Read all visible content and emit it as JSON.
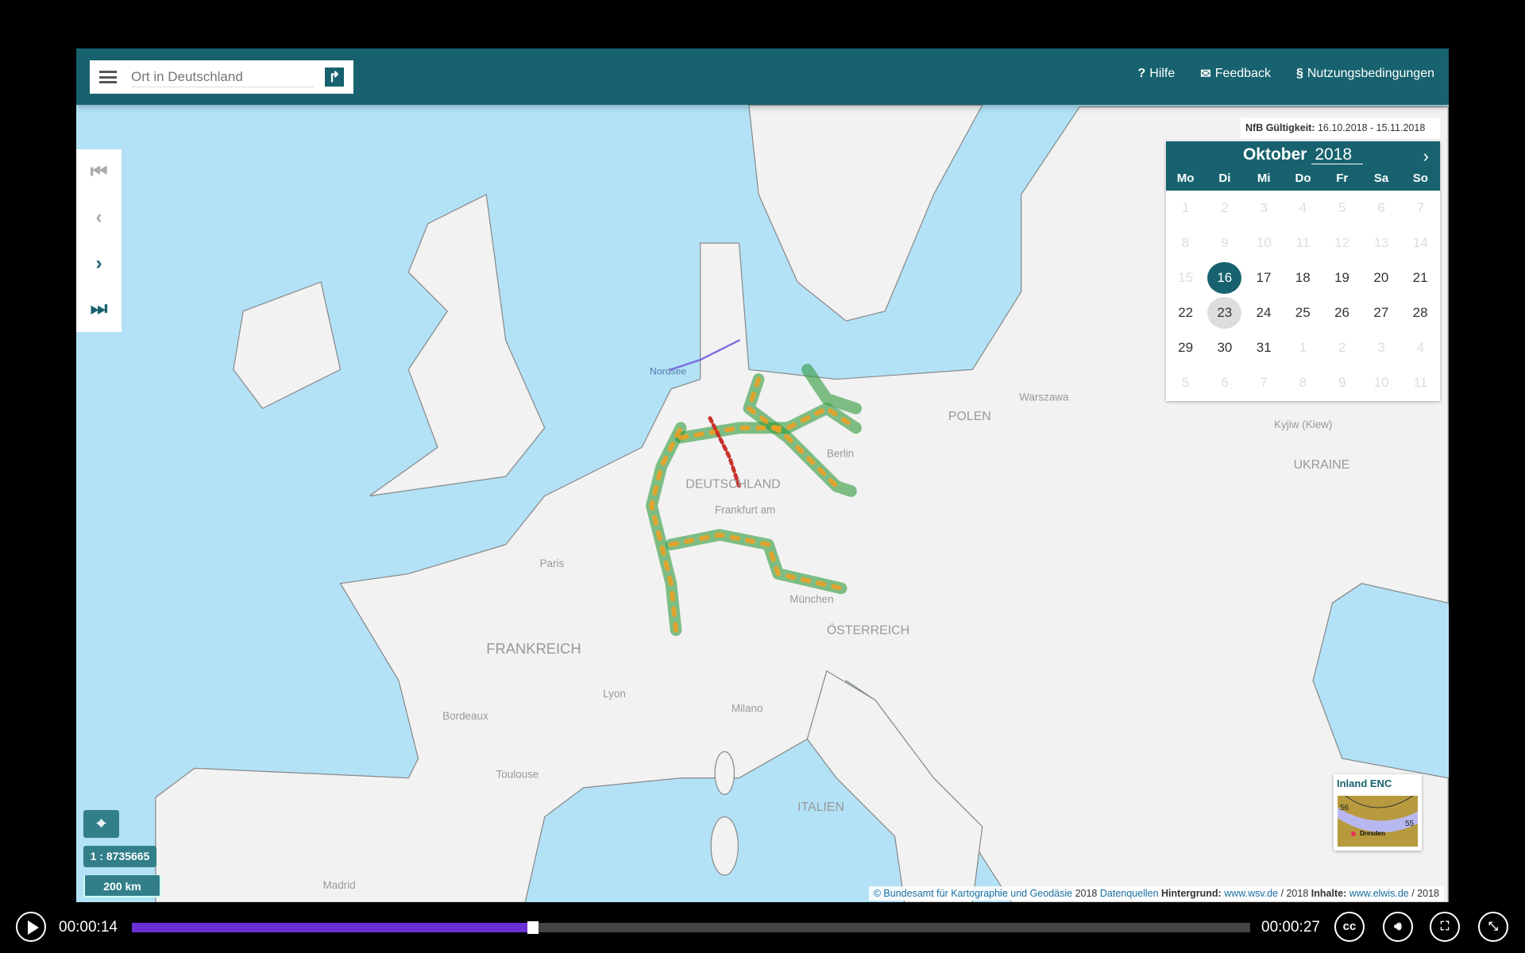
{
  "header": {
    "search_placeholder": "Ort in Deutschland",
    "nav": [
      "Hilfe",
      "Feedback",
      "Nutzungsbedingungen"
    ]
  },
  "map": {
    "labels": [
      "Nordsee",
      "DEUTSCHLAND",
      "FRANKREICH",
      "POLEN",
      "UKRAINE",
      "ITALIEN",
      "ÖSTERREICH",
      "Frankfurt am",
      "München",
      "Paris",
      "Warszawa",
      "Madrid",
      "Toulouse",
      "Bordeaux",
      "Lyon",
      "Milano",
      "Kyjiw (Kiew)",
      "Berlin"
    ],
    "scale": "1 : 8735665",
    "scalebar": "200 km",
    "attribution": {
      "copyright": "© Bundesamt für Kartographie und Geodäsie",
      "year1": "2018",
      "sources": "Datenquellen",
      "bg_label": "Hintergrund:",
      "bg_link": "www.wsv.de",
      "bg_year": "/ 2018",
      "content_label": "Inhalte:",
      "content_link": "www.elwis.de",
      "content_year": "/ 2018"
    },
    "colors": {
      "water": "#b3e2f7",
      "land": "#f2f2f2",
      "route_green": "#2e9a3a",
      "route_orange": "#f0a020",
      "route_red": "#c8322a"
    }
  },
  "validity": {
    "label": "NfB Gültigkeit:",
    "value": "16.10.2018 - 15.11.2018"
  },
  "calendar": {
    "month": "Oktober",
    "year": "2018",
    "weekdays": [
      "Mo",
      "Di",
      "Mi",
      "Do",
      "Fr",
      "Sa",
      "So"
    ],
    "selected": "16",
    "today": "23",
    "weeks": [
      [
        "1",
        "2",
        "3",
        "4",
        "5",
        "6",
        "7"
      ],
      [
        "8",
        "9",
        "10",
        "11",
        "12",
        "13",
        "14"
      ],
      [
        "15",
        "16",
        "17",
        "18",
        "19",
        "20",
        "21"
      ],
      [
        "22",
        "23",
        "24",
        "25",
        "26",
        "27",
        "28"
      ],
      [
        "29",
        "30",
        "31",
        "1",
        "2",
        "3",
        "4"
      ],
      [
        "5",
        "6",
        "7",
        "8",
        "9",
        "10",
        "11"
      ]
    ],
    "muted": [
      [
        1,
        1,
        1,
        1,
        1,
        1,
        1
      ],
      [
        1,
        1,
        1,
        1,
        1,
        1,
        1
      ],
      [
        1,
        0,
        0,
        0,
        0,
        0,
        0
      ],
      [
        0,
        0,
        0,
        0,
        0,
        0,
        0
      ],
      [
        0,
        0,
        0,
        1,
        1,
        1,
        1
      ],
      [
        1,
        1,
        1,
        1,
        1,
        1,
        1
      ]
    ]
  },
  "overview": {
    "title": "Inland ENC",
    "labels": [
      "56",
      "55",
      "Dresden"
    ]
  },
  "player": {
    "current": "00:00:14",
    "total": "00:00:27",
    "progress": 0.359,
    "buttons": [
      "cc",
      "volume",
      "fullscreen",
      "exit-fullscreen"
    ]
  }
}
